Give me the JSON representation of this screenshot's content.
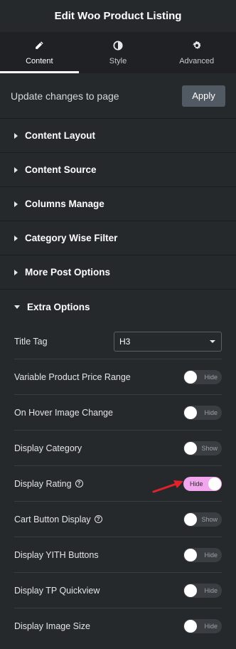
{
  "header": {
    "title": "Edit Woo Product Listing"
  },
  "tabs": [
    {
      "label": "Content",
      "icon": "pencil-icon",
      "active": true
    },
    {
      "label": "Style",
      "icon": "contrast-icon",
      "active": false
    },
    {
      "label": "Advanced",
      "icon": "gear-icon",
      "active": false
    }
  ],
  "update": {
    "text": "Update changes to page",
    "apply_label": "Apply"
  },
  "sections": [
    {
      "label": "Content Layout"
    },
    {
      "label": "Content Source"
    },
    {
      "label": "Columns Manage"
    },
    {
      "label": "Category Wise Filter"
    },
    {
      "label": "More Post Options"
    },
    {
      "label": "Extra Options"
    }
  ],
  "extra_options": {
    "title_tag": {
      "label": "Title Tag",
      "value": "H3"
    },
    "toggles": [
      {
        "label": "Variable Product Price Range",
        "state": "Hide",
        "on": false,
        "help": false
      },
      {
        "label": "On Hover Image Change",
        "state": "Hide",
        "on": false,
        "help": false
      },
      {
        "label": "Display Category",
        "state": "Show",
        "on": false,
        "help": false
      },
      {
        "label": "Display Rating",
        "state": "Hide",
        "on": true,
        "help": true
      },
      {
        "label": "Cart Button Display",
        "state": "Show",
        "on": false,
        "help": true
      },
      {
        "label": "Display YITH Buttons",
        "state": "Hide",
        "on": false,
        "help": false
      },
      {
        "label": "Display TP Quickview",
        "state": "Hide",
        "on": false,
        "help": false
      },
      {
        "label": "Display Image Size",
        "state": "Hide",
        "on": false,
        "help": false
      }
    ]
  },
  "colors": {
    "toggle_on": "#f1a6ed",
    "annotation_arrow": "#e0232b",
    "apply_button": "#515962"
  }
}
